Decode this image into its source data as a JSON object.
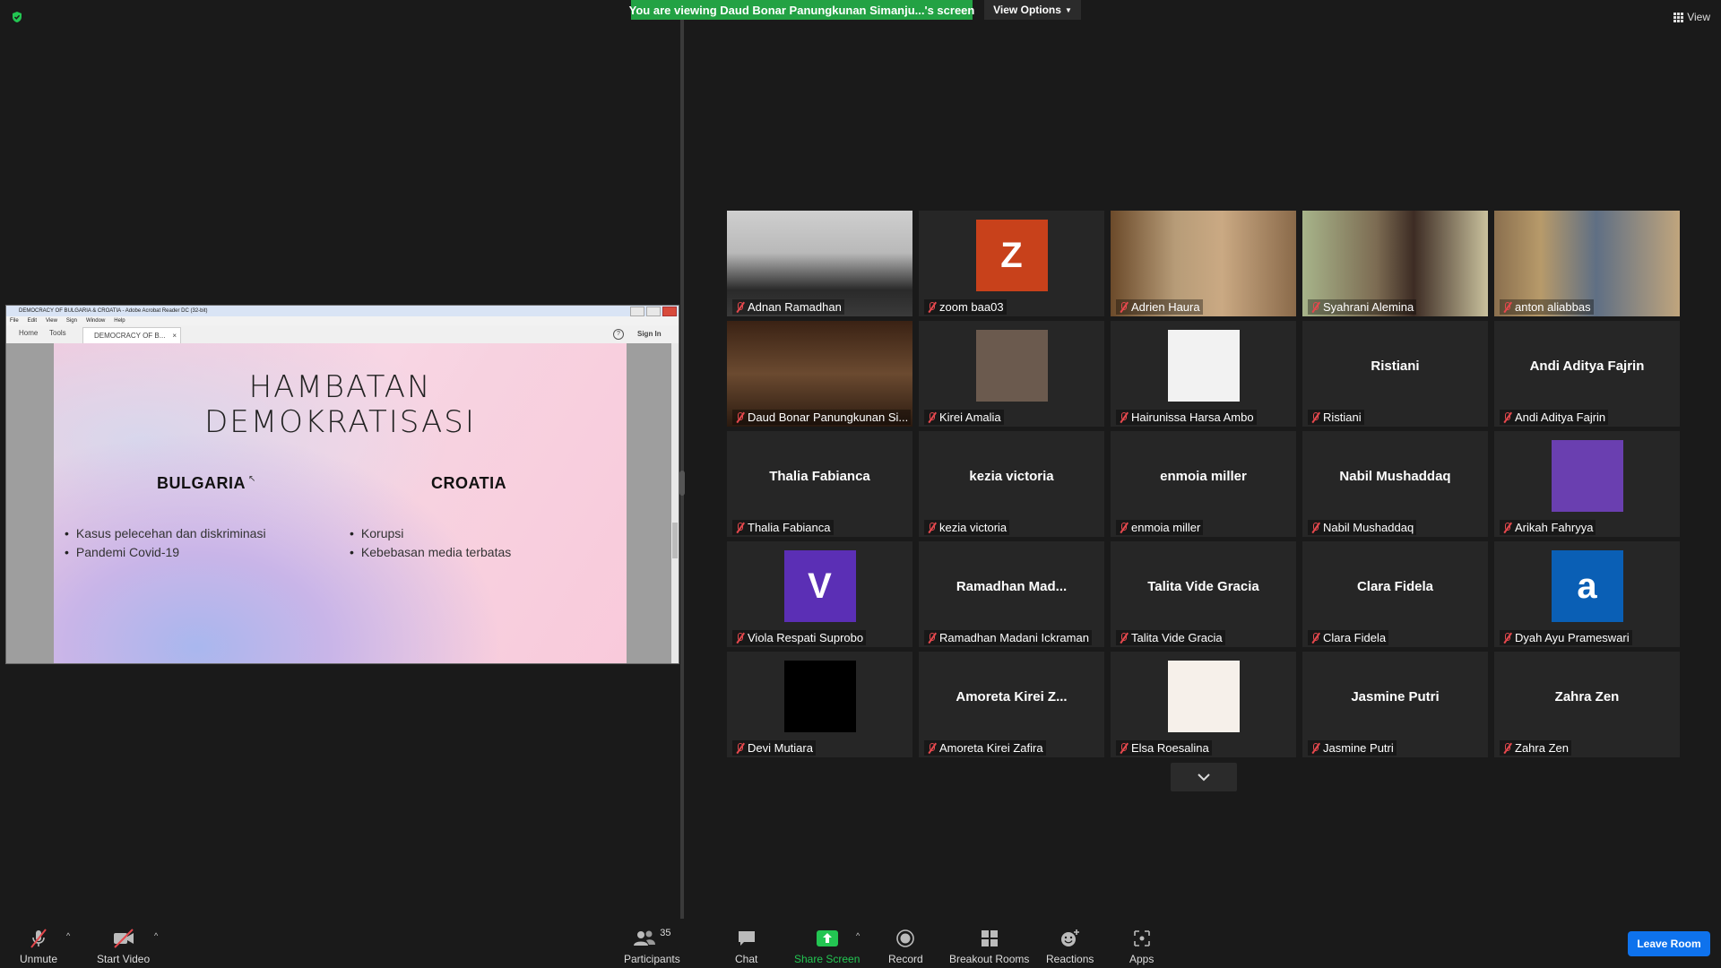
{
  "banner": {
    "text": "You are viewing Daud Bonar Panungkunan Simanju...'s screen",
    "view_options": "View Options"
  },
  "top_right": {
    "view_label": "View"
  },
  "shared_screen": {
    "window_title": "DEMOCRACY OF BULGARIA & CROATIA - Adobe Acrobat Reader DC (32-bit)",
    "menu": [
      "File",
      "Edit",
      "View",
      "Sign",
      "Window",
      "Help"
    ],
    "tabs": {
      "home": "Home",
      "tools": "Tools",
      "document": "DEMOCRACY OF B..."
    },
    "help": "?",
    "sign_in": "Sign In",
    "slide": {
      "title_line1": "HAMBATAN",
      "title_line2": "DEMOKRATISASI",
      "left_heading": "BULGARIA",
      "left_items": [
        "Kasus pelecehan dan diskriminasi",
        "Pandemi Covid-19"
      ],
      "right_heading": "CROATIA",
      "right_items": [
        "Korupsi",
        "Kebebasan media terbatas"
      ]
    }
  },
  "participants": [
    {
      "name": "Adnan Ramadhan",
      "display": "",
      "kind": "video"
    },
    {
      "name": "zoom baa03",
      "display": "Z",
      "kind": "avatar",
      "color": "#c8411b"
    },
    {
      "name": "Adrien Haura",
      "display": "",
      "kind": "video"
    },
    {
      "name": "Syahrani Alemina",
      "display": "",
      "kind": "video",
      "active": true
    },
    {
      "name": "anton aliabbas",
      "display": "",
      "kind": "video"
    },
    {
      "name": "Daud Bonar Panungkunan Si...",
      "display": "",
      "kind": "video"
    },
    {
      "name": "Kirei Amalia",
      "display": "",
      "kind": "photo"
    },
    {
      "name": "Hairunissa Harsa Ambo",
      "display": "",
      "kind": "photo"
    },
    {
      "name": "Ristiani",
      "display": "Ristiani",
      "kind": "text"
    },
    {
      "name": "Andi Aditya Fajrin",
      "display": "Andi Aditya Fajrin",
      "kind": "text"
    },
    {
      "name": "Thalia Fabianca",
      "display": "Thalia Fabianca",
      "kind": "text"
    },
    {
      "name": "kezia victoria",
      "display": "kezia victoria",
      "kind": "text"
    },
    {
      "name": "enmoia miller",
      "display": "enmoia miller",
      "kind": "text"
    },
    {
      "name": "Nabil Mushaddaq",
      "display": "Nabil Mushaddaq",
      "kind": "text"
    },
    {
      "name": "Arikah Fahryya",
      "display": "",
      "kind": "photo"
    },
    {
      "name": "Viola Respati Suprobo",
      "display": "V",
      "kind": "avatar",
      "color": "#5b2fb5"
    },
    {
      "name": "Ramadhan Madani Ickraman",
      "display": "Ramadhan  Mad...",
      "kind": "text"
    },
    {
      "name": "Talita Vide Gracia",
      "display": "Talita Vide Gracia",
      "kind": "text"
    },
    {
      "name": "Clara Fidela",
      "display": "Clara Fidela",
      "kind": "text"
    },
    {
      "name": "Dyah Ayu Prameswari",
      "display": "a",
      "kind": "avatar",
      "color": "#0a5fb5"
    },
    {
      "name": "Devi Mutiara",
      "display": "",
      "kind": "photo"
    },
    {
      "name": "Amoreta Kirei Zafira",
      "display": "Amoreta Kirei Z...",
      "kind": "text"
    },
    {
      "name": "Elsa Roesalina",
      "display": "",
      "kind": "photo"
    },
    {
      "name": "Jasmine Putri",
      "display": "Jasmine Putri",
      "kind": "text"
    },
    {
      "name": "Zahra Zen",
      "display": "Zahra Zen",
      "kind": "text"
    }
  ],
  "toolbar": {
    "unmute": "Unmute",
    "start_video": "Start Video",
    "participants": "Participants",
    "participants_count": "35",
    "chat": "Chat",
    "share_screen": "Share Screen",
    "record": "Record",
    "breakout_rooms": "Breakout Rooms",
    "reactions": "Reactions",
    "apps": "Apps",
    "leave_room": "Leave Room"
  },
  "colors": {
    "banner_green": "#23a244",
    "share_green": "#23c552",
    "leave_blue": "#0e72ed",
    "active_speaker": "#f1e07a",
    "muted_red": "#e5484d"
  }
}
